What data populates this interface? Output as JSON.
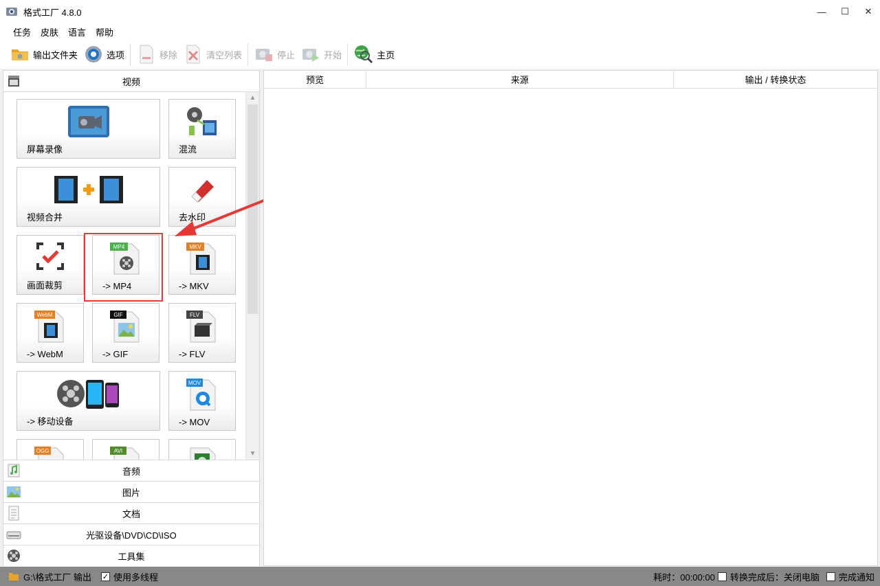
{
  "window": {
    "title": "格式工厂 4.8.0",
    "minimize": "—",
    "maximize": "☐",
    "close": "✕"
  },
  "menu": [
    "任务",
    "皮肤",
    "语言",
    "帮助"
  ],
  "toolbar": {
    "output_folder": "输出文件夹",
    "options": "选项",
    "remove": "移除",
    "clear_list": "清空列表",
    "stop": "停止",
    "start": "开始",
    "home": "主页"
  },
  "categories": {
    "video": "视频",
    "audio": "音频",
    "image": "图片",
    "document": "文档",
    "optical": "光驱设备\\DVD\\CD\\ISO",
    "tools": "工具集"
  },
  "tiles": {
    "screen_record": "屏幕录像",
    "mux": "混流",
    "video_merge": "视频合并",
    "remove_watermark": "去水印",
    "crop": "画面裁剪",
    "to_mp4": "-> MP4",
    "to_mkv": "-> MKV",
    "to_webm": "-> WebM",
    "to_gif": "-> GIF",
    "to_flv": "-> FLV",
    "to_mobile": "-> 移动设备",
    "to_mov": "-> MOV"
  },
  "badges": {
    "mp4": "MP4",
    "mkv": "MKV",
    "webm": "WebM",
    "gif": "GIF",
    "flv": "FLV",
    "mov": "MOV",
    "ogg": "OGG",
    "avi": "AVI"
  },
  "columns": [
    "预览",
    "来源",
    "输出 / 转换状态"
  ],
  "status": {
    "output_path": "G:\\格式工厂 输出",
    "multithread_label": "使用多线程",
    "multithread_checked": true,
    "elapsed_label": "耗时：00:00:00",
    "after_convert_label": "转换完成后：关闭电脑",
    "after_convert_checked": false,
    "notify_label": "完成通知",
    "notify_checked": false
  },
  "colors": {
    "highlight": "#e53935",
    "statusbar": "#888888"
  }
}
